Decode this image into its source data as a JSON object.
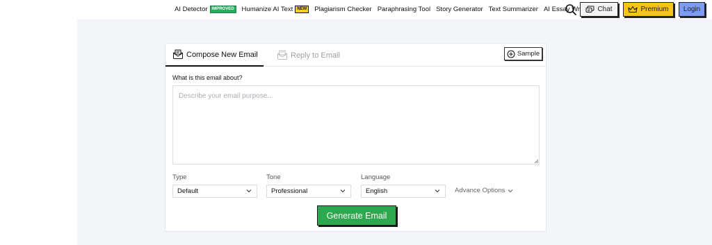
{
  "nav": {
    "items": [
      {
        "label": "AI Detector",
        "badge": "IMPROVED"
      },
      {
        "label": "Humanize AI Text",
        "badge": "NEW"
      },
      {
        "label": "Plagiarism Checker"
      },
      {
        "label": "Paraphrasing Tool"
      },
      {
        "label": "Story Generator"
      },
      {
        "label": "Text Summarizer"
      },
      {
        "label": "AI Essay Writer"
      }
    ],
    "chat_label": "Chat",
    "premium_label": "Premium",
    "login_label": "Login"
  },
  "tabs": {
    "compose_label": "Compose New Email",
    "reply_label": "Reply to Email",
    "sample_label": "Sample"
  },
  "form": {
    "question": "What is this email about?",
    "textarea_placeholder": "Describe your email purpose...",
    "type_label": "Type",
    "type_value": "Default",
    "tone_label": "Tone",
    "tone_value": "Professional",
    "language_label": "Language",
    "language_value": "English",
    "advance_label": "Advance Options",
    "generate_label": "Generate Email"
  },
  "colors": {
    "primary_green": "#2ea84f",
    "premium_yellow": "#f5c518",
    "login_blue": "#7f9cf5",
    "badge_green": "#27ae60",
    "badge_yellow": "#f5d020"
  }
}
